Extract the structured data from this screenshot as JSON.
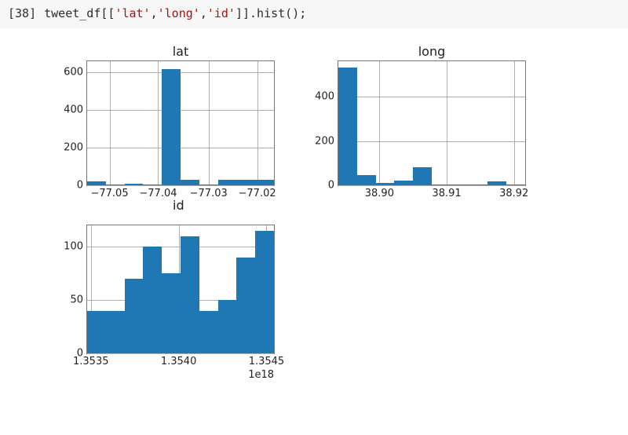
{
  "cell": {
    "prompt": "[38]",
    "code_parts": {
      "p1": "tweet_df[[",
      "s1": "'lat'",
      "c1": ",",
      "s2": "'long'",
      "c2": ",",
      "s3": "'id'",
      "p2": "]].hist();"
    }
  },
  "chart_data": [
    {
      "name": "lat",
      "type": "bar",
      "title": "lat",
      "xlabel": "",
      "ylabel": "",
      "categories": [
        "-77.054",
        "-77.050",
        "-77.046",
        "-77.042",
        "-77.038",
        "-77.034",
        "-77.030",
        "-77.026",
        "-77.022",
        "-77.018"
      ],
      "values": [
        20,
        5,
        10,
        5,
        620,
        30,
        5,
        30,
        30,
        30
      ],
      "xticks": [
        "−77.05",
        "−77.04",
        "−77.03",
        "−77.02"
      ],
      "xtick_positions": [
        0.12,
        0.38,
        0.65,
        0.91
      ],
      "yticks": [
        "0",
        "200",
        "400",
        "600"
      ],
      "ylim": [
        0,
        660
      ]
    },
    {
      "name": "long",
      "type": "bar",
      "title": "long",
      "xlabel": "",
      "ylabel": "",
      "categories": [
        "38.894",
        "38.897",
        "38.900",
        "38.903",
        "38.906",
        "38.909",
        "38.912",
        "38.915",
        "38.918",
        "38.921"
      ],
      "values": [
        530,
        45,
        10,
        20,
        80,
        3,
        3,
        3,
        18,
        3
      ],
      "xticks": [
        "38.90",
        "38.91",
        "38.92"
      ],
      "xtick_positions": [
        0.22,
        0.58,
        0.94
      ],
      "yticks": [
        "0",
        "200",
        "400"
      ],
      "ylim": [
        0,
        560
      ]
    },
    {
      "name": "id",
      "type": "bar",
      "title": "id",
      "xlabel": "",
      "ylabel": "",
      "categories": [
        "1.35350",
        "1.35362",
        "1.35374",
        "1.35386",
        "1.35398",
        "1.35410",
        "1.35422",
        "1.35434",
        "1.35446",
        "1.35458"
      ],
      "values": [
        40,
        40,
        70,
        100,
        75,
        110,
        40,
        50,
        90,
        115
      ],
      "xticks": [
        "1.3535",
        "1.3540",
        "1.3545"
      ],
      "xtick_positions": [
        0.02,
        0.49,
        0.96
      ],
      "yticks": [
        "0",
        "50",
        "100"
      ],
      "ylim": [
        0,
        120
      ],
      "offset_text": "1e18"
    }
  ]
}
